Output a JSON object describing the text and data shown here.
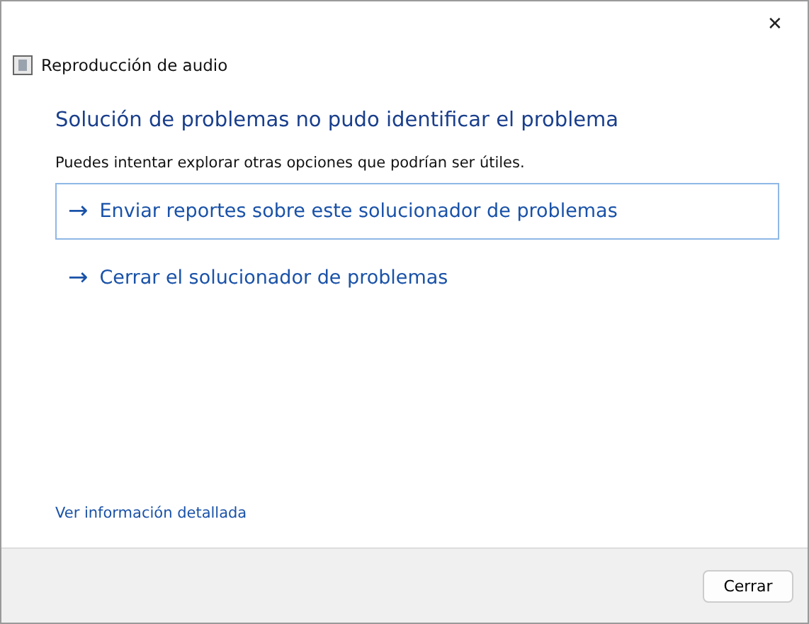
{
  "window": {
    "title": "Reproducción de audio",
    "close": "✕"
  },
  "heading": "Solución de problemas no pudo identificar el problema",
  "description": "Puedes intentar explorar otras opciones que podrían ser útiles.",
  "options": [
    {
      "arrow": "→",
      "label": "Enviar reportes sobre este solucionador de problemas",
      "selected": true
    },
    {
      "arrow": "→",
      "label": "Cerrar el solucionador de problemas",
      "selected": false
    }
  ],
  "details_link": "Ver información detallada",
  "buttons": [
    "Cerrar"
  ]
}
